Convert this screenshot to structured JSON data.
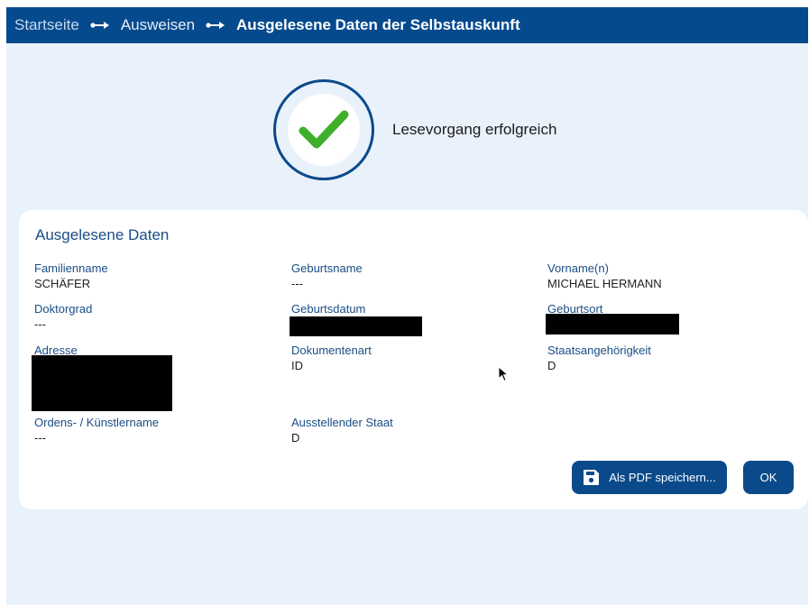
{
  "breadcrumb": {
    "items": [
      {
        "label": "Startseite"
      },
      {
        "label": "Ausweisen"
      },
      {
        "label": "Ausgelesene Daten der Selbstauskunft"
      }
    ]
  },
  "status": {
    "message": "Lesevorgang erfolgreich",
    "icon": "checkmark-icon",
    "check_color": "#3fae2a"
  },
  "card": {
    "title": "Ausgelesene Daten",
    "fields": {
      "familienname": {
        "label": "Familienname",
        "value": "SCHÄFER"
      },
      "geburtsname": {
        "label": "Geburtsname",
        "value": "---"
      },
      "vorname": {
        "label": "Vorname(n)",
        "value": "MICHAEL HERMANN"
      },
      "doktorgrad": {
        "label": "Doktorgrad",
        "value": "---"
      },
      "geburtsdatum": {
        "label": "Geburtsdatum",
        "value": ""
      },
      "geburtsort": {
        "label": "Geburtsort",
        "value": ""
      },
      "adresse": {
        "label": "Adresse",
        "value": ""
      },
      "dokumentenart": {
        "label": "Dokumentenart",
        "value": "ID"
      },
      "staatsangehoerigkeit": {
        "label": "Staatsangehörigkeit",
        "value": "D"
      },
      "ordensname": {
        "label": "Ordens- / Künstlername",
        "value": "---"
      },
      "ausstellender_staat": {
        "label": "Ausstellender Staat",
        "value": "D"
      }
    }
  },
  "actions": {
    "save_pdf_label": "Als PDF speichern...",
    "save_pdf_icon": "floppy-disk-icon",
    "ok_label": "OK"
  },
  "colors": {
    "topbar": "#064a8e",
    "accent": "#0a4a8a",
    "background": "#e9f1fb"
  }
}
